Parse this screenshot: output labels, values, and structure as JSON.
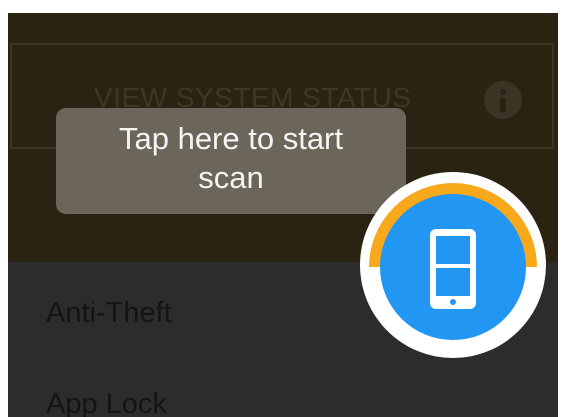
{
  "status_button": {
    "label": "VIEW SYSTEM STATUS",
    "icon": "info-icon"
  },
  "tooltip": {
    "line1": "Tap here to start",
    "line2": "scan"
  },
  "menu": {
    "items": [
      {
        "label": "Anti-Theft"
      },
      {
        "label": "App Lock"
      }
    ]
  },
  "scan_button": {
    "icon": "phone-icon",
    "progress_color": "#f7a81b",
    "fill_color": "#2196f3"
  },
  "colors": {
    "overlay_top": "#2b2312",
    "overlay_bottom": "#2c2c2c",
    "tooltip_bg": "#6b6659",
    "tooltip_text": "#f4f4f4"
  }
}
